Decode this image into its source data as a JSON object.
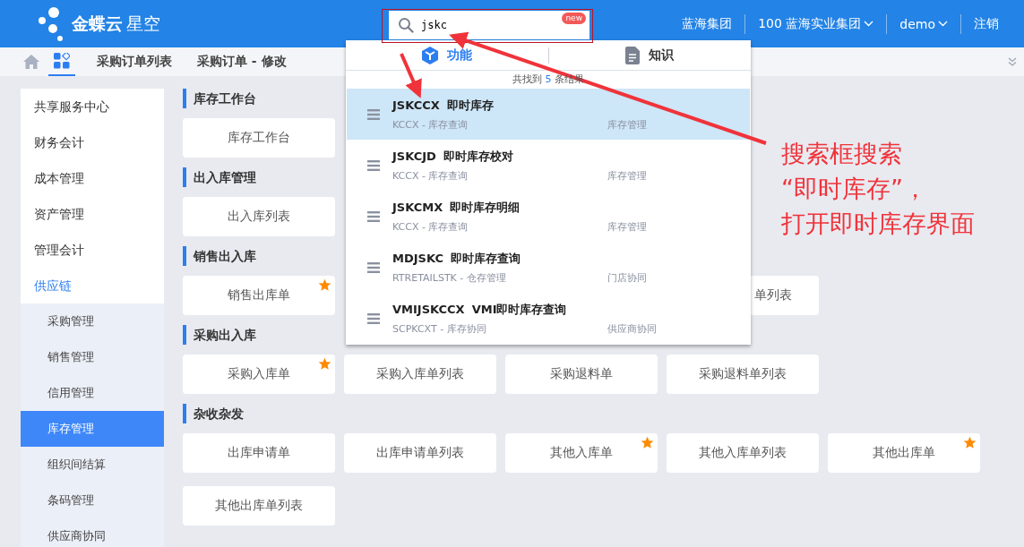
{
  "logo": {
    "brand": "金蝶云",
    "product": "星空"
  },
  "search": {
    "value": "jskc",
    "badge": "new"
  },
  "header_menu": [
    {
      "label": "蓝海集团",
      "has_menu": false
    },
    {
      "label": "100 蓝海实业集团",
      "has_menu": true
    },
    {
      "label": "demo",
      "has_menu": true
    },
    {
      "label": "注销",
      "has_menu": false
    }
  ],
  "tabs": [
    {
      "label": "采购订单列表",
      "selected": false
    },
    {
      "label": "采购订单 - 修改",
      "selected": false
    }
  ],
  "apps_tab_selected": true,
  "sidebar": [
    {
      "label": "共享服务中心",
      "kind": "group",
      "selected": false
    },
    {
      "label": "财务会计",
      "kind": "group",
      "selected": false
    },
    {
      "label": "成本管理",
      "kind": "group",
      "selected": false
    },
    {
      "label": "资产管理",
      "kind": "group",
      "selected": false
    },
    {
      "label": "管理会计",
      "kind": "group",
      "selected": false
    },
    {
      "label": "供应链",
      "kind": "group",
      "selected": true
    },
    {
      "label": "采购管理",
      "kind": "sub",
      "selected": false
    },
    {
      "label": "销售管理",
      "kind": "sub",
      "selected": false
    },
    {
      "label": "信用管理",
      "kind": "sub",
      "selected": false
    },
    {
      "label": "库存管理",
      "kind": "sub",
      "selected": true
    },
    {
      "label": "组织间结算",
      "kind": "sub",
      "selected": false
    },
    {
      "label": "条码管理",
      "kind": "sub",
      "selected": false
    },
    {
      "label": "供应商协同",
      "kind": "sub",
      "selected": false
    }
  ],
  "sections": [
    {
      "title": "库存工作台",
      "cards": [
        {
          "label": "库存工作台",
          "favorite": false
        }
      ]
    },
    {
      "title": "出入库管理",
      "cards": [
        {
          "label": "出入库列表",
          "favorite": false
        }
      ]
    },
    {
      "title": "销售出入库",
      "cards": [
        {
          "label": "销售出库单",
          "favorite": true
        },
        {
          "label": "单列表",
          "favorite": false
        }
      ]
    },
    {
      "title": "采购出入库",
      "cards": [
        {
          "label": "采购入库单",
          "favorite": true
        },
        {
          "label": "采购入库单列表",
          "favorite": false
        },
        {
          "label": "采购退料单",
          "favorite": false
        },
        {
          "label": "采购退料单列表",
          "favorite": false
        }
      ]
    },
    {
      "title": "杂收杂发",
      "cards": [
        {
          "label": "出库申请单",
          "favorite": false
        },
        {
          "label": "出库申请单列表",
          "favorite": false
        },
        {
          "label": "其他入库单",
          "favorite": true
        },
        {
          "label": "其他入库单列表",
          "favorite": false
        },
        {
          "label": "其他出库单",
          "favorite": true
        },
        {
          "label": "其他出库单列表",
          "favorite": false
        }
      ]
    }
  ],
  "dropdown": {
    "tabs": [
      {
        "label": "功能",
        "selected": true
      },
      {
        "label": "知识",
        "selected": false
      }
    ],
    "summary": {
      "before": "共找到",
      "count": "5",
      "after": "条结果"
    },
    "results": [
      {
        "code": "JSKCCX",
        "name": "即时库存",
        "path": "KCCX - 库存查询",
        "module": "库存管理",
        "selected": true
      },
      {
        "code": "JSKCJD",
        "name": "即时库存校对",
        "path": "KCCX - 库存查询",
        "module": "库存管理",
        "selected": false
      },
      {
        "code": "JSKCMX",
        "name": "即时库存明细",
        "path": "KCCX - 库存查询",
        "module": "库存管理",
        "selected": false
      },
      {
        "code": "MDJSKC",
        "name": "即时库存查询",
        "path": "RTRETAILSTK - 仓存管理",
        "module": "门店协同",
        "selected": false
      },
      {
        "code": "VMIJSKCCX",
        "name": "VMI即时库存查询",
        "path": "SCPKCXT - 库存协同",
        "module": "供应商协同",
        "selected": false
      }
    ]
  },
  "annotation": {
    "lines": [
      "搜索框搜索",
      "“即时库存”，",
      "打开即时库存界面"
    ]
  }
}
